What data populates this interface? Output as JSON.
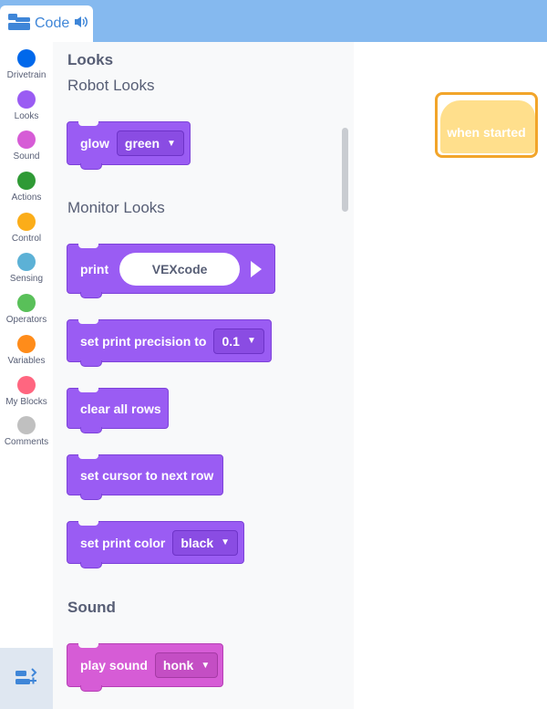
{
  "code_tab": {
    "label": "Code",
    "icon": "code-blocks-icon",
    "audio_icon": "speaker-icon"
  },
  "categories": [
    {
      "label": "Drivetrain",
      "color": "#0068eb"
    },
    {
      "label": "Looks",
      "color": "#9a5cf3"
    },
    {
      "label": "Sound",
      "color": "#d65cd6"
    },
    {
      "label": "Actions",
      "color": "#2f9a35"
    },
    {
      "label": "Control",
      "color": "#fbad19"
    },
    {
      "label": "Sensing",
      "color": "#5cb1d6"
    },
    {
      "label": "Operators",
      "color": "#59c059"
    },
    {
      "label": "Variables",
      "color": "#ff8c1a"
    },
    {
      "label": "My Blocks",
      "color": "#ff6680"
    },
    {
      "label": "Comments",
      "color": "#c0c0c0"
    }
  ],
  "palette": {
    "section_looks": "Looks",
    "sub_robot_looks": "Robot Looks",
    "sub_monitor_looks": "Monitor Looks",
    "section_sound": "Sound",
    "blocks": {
      "glow": {
        "label": "glow",
        "value": "green"
      },
      "print": {
        "label": "print",
        "value": "VEXcode"
      },
      "precision": {
        "label": "set print precision to",
        "value": "0.1"
      },
      "clear_rows": {
        "label": "clear all rows"
      },
      "cursor_next": {
        "label": "set cursor to next row"
      },
      "print_color": {
        "label": "set print color",
        "value": "black"
      },
      "play_sound": {
        "label": "play sound",
        "value": "honk"
      }
    }
  },
  "workspace": {
    "hat_label": "when started"
  },
  "colors": {
    "topbar": "#85b9ef",
    "looks_block": "#9a5cf3",
    "sound_block": "#d65cd6",
    "hat_block": "#ffdf8c",
    "hat_outline": "#f2a52a"
  }
}
